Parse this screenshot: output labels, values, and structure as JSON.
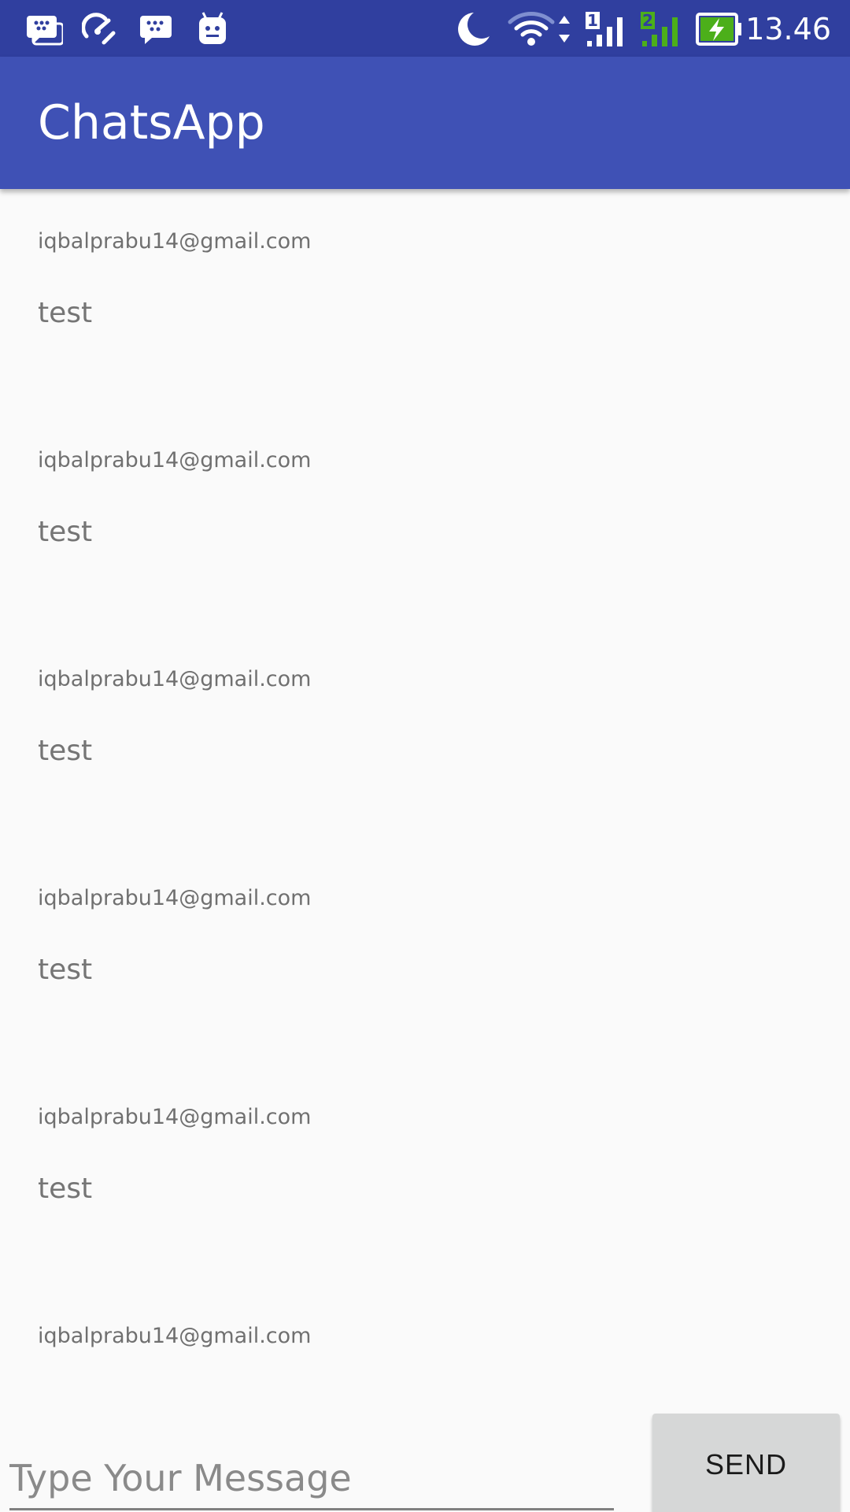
{
  "status_bar": {
    "time": "13.46",
    "sim1_label": "1",
    "sim2_label": "2",
    "icons": [
      "bbm-notification-icon",
      "speed-tool-icon",
      "bbm-chat-icon",
      "android-icon",
      "night-mode-icon",
      "wifi-icon",
      "data-arrows-icon",
      "signal-sim1-icon",
      "signal-sim2-icon",
      "battery-charging-icon"
    ],
    "colors": {
      "status_bar_bg": "#303f9f",
      "sim2_signal": "#4caf1a",
      "battery_fill": "#4caf1a"
    }
  },
  "app_bar": {
    "title": "ChatsApp",
    "color": "#3f51b5"
  },
  "messages": [
    {
      "sender": "iqbalprabu14@gmail.com",
      "text": "test"
    },
    {
      "sender": "iqbalprabu14@gmail.com",
      "text": "test"
    },
    {
      "sender": "iqbalprabu14@gmail.com",
      "text": "test"
    },
    {
      "sender": "iqbalprabu14@gmail.com",
      "text": "test"
    },
    {
      "sender": "iqbalprabu14@gmail.com",
      "text": "test"
    },
    {
      "sender": "iqbalprabu14@gmail.com",
      "text": ""
    }
  ],
  "composer": {
    "value": "",
    "placeholder": "Type Your Message",
    "send_label": "SEND"
  }
}
